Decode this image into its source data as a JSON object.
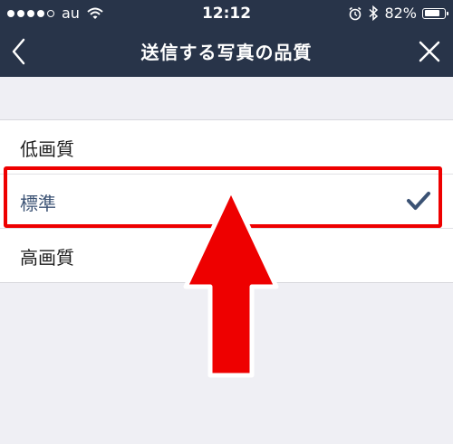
{
  "status_bar": {
    "carrier": "au",
    "time": "12:12",
    "battery_percent_text": "82%",
    "battery_level": 0.82
  },
  "nav": {
    "title": "送信する写真の品質",
    "back_icon": "chevron-left-icon",
    "close_icon": "close-icon"
  },
  "options": [
    {
      "label": "低画質",
      "selected": false
    },
    {
      "label": "標準",
      "selected": true
    },
    {
      "label": "高画質",
      "selected": false
    }
  ],
  "colors": {
    "header_bg": "#283449",
    "background": "#efeff4",
    "selected_text": "#3b5274",
    "check": "#3b5274",
    "annotation_red": "#ee0000"
  }
}
